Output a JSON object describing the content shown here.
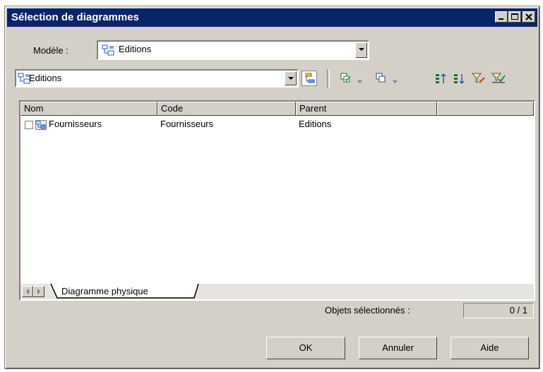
{
  "window": {
    "title": "Sélection de diagrammes"
  },
  "model": {
    "label": "Modèle :",
    "value": "Editions"
  },
  "package": {
    "value": "Editions"
  },
  "toolbar": {
    "icons": [
      "include-subpackages-icon",
      "select-all-icon",
      "deselect-all-icon",
      "move-up-icon",
      "move-down-icon",
      "filter-edit-icon",
      "filter-clear-icon"
    ]
  },
  "table": {
    "columns": [
      "Nom",
      "Code",
      "Parent"
    ],
    "rows": [
      {
        "name": "Fournisseurs",
        "code": "Fournisseurs",
        "parent": "Editions",
        "checked": false
      }
    ]
  },
  "tabs": [
    "Diagramme physique"
  ],
  "status": {
    "label": "Objets sélectionnés :",
    "value": "0 / 1"
  },
  "buttons": {
    "ok": "OK",
    "cancel": "Annuler",
    "help": "Aide"
  },
  "colors": {
    "titlebar": "#0a246a",
    "face": "#d4d0c8"
  }
}
